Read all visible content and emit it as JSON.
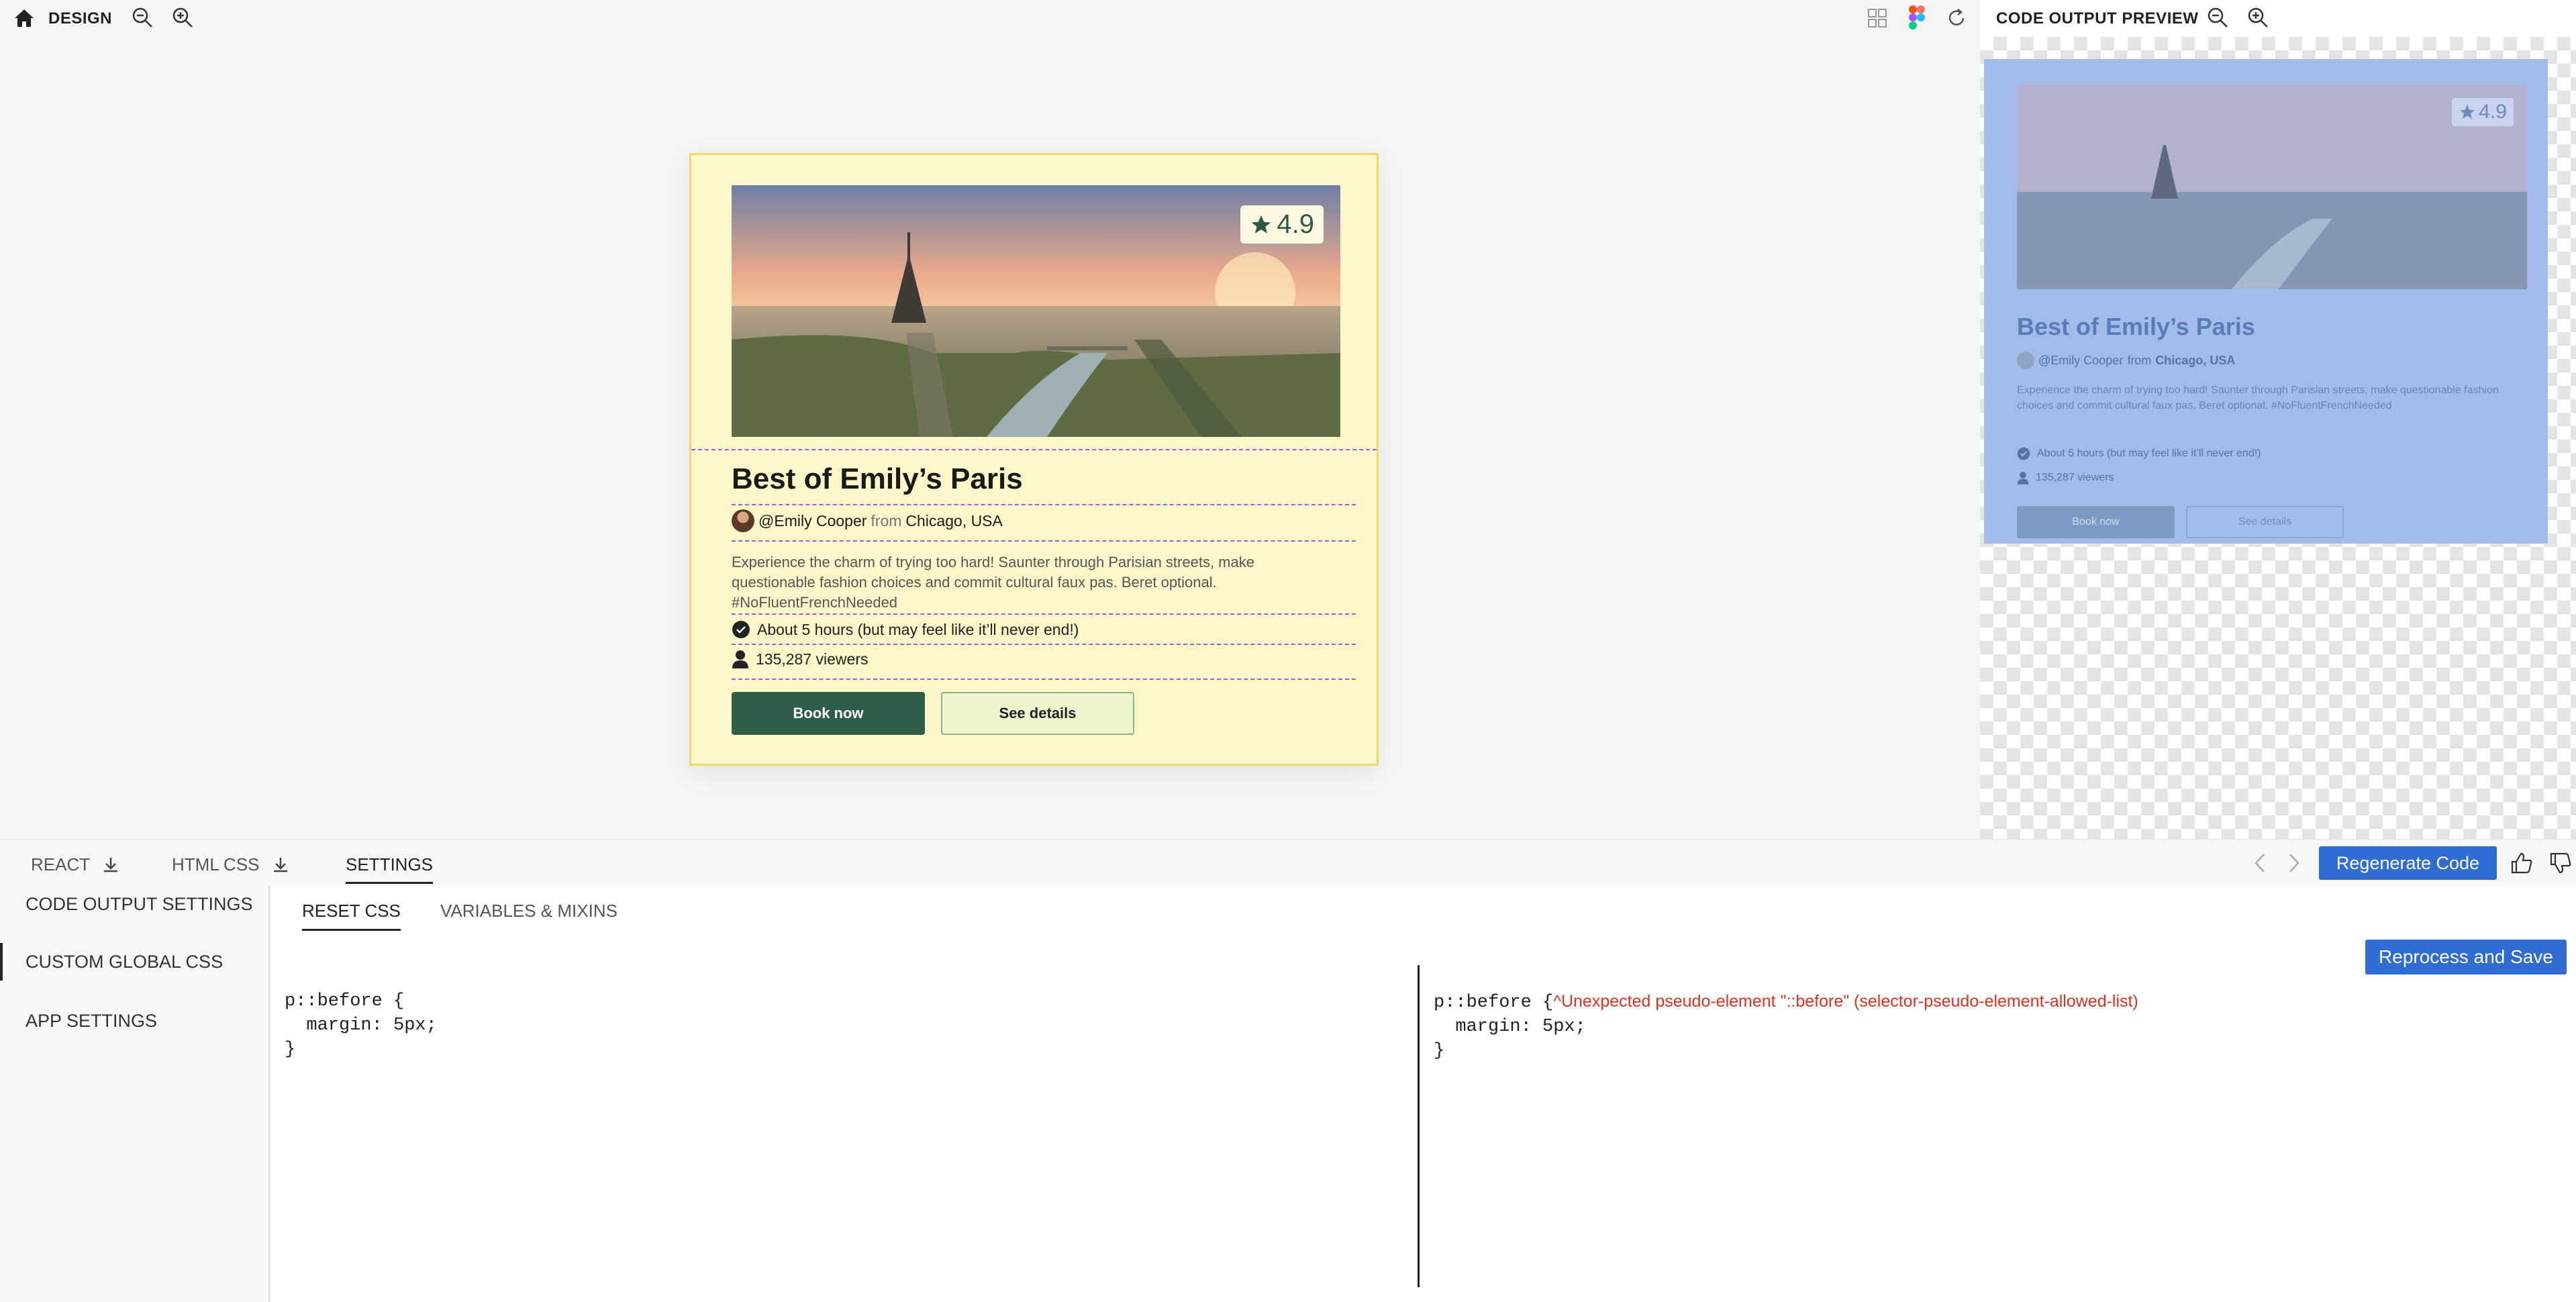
{
  "design_bar": {
    "title": "DESIGN"
  },
  "preview_bar": {
    "title": "CODE OUTPUT PREVIEW"
  },
  "card": {
    "rating": "4.9",
    "title": "Best of Emily’s Paris",
    "author": "@Emily Cooper",
    "from_word": "from",
    "location": "Chicago, USA",
    "description": "Experience the charm of trying too hard! Saunter through Parisian streets, make questionable fashion choices and commit cultural faux pas. Beret optional. #NoFluentFrenchNeeded",
    "duration": "About 5 hours (but may feel like it’ll never end!)",
    "viewers": "135,287 viewers",
    "book_label": "Book now",
    "details_label": "See details"
  },
  "bottom_tabs": {
    "react": "REACT",
    "html_css": "HTML CSS",
    "settings": "SETTINGS",
    "regenerate": "Regenerate Code"
  },
  "settings_sidebar": {
    "items": [
      "CODE OUTPUT SETTINGS",
      "CUSTOM GLOBAL CSS",
      "APP SETTINGS"
    ]
  },
  "editor": {
    "tabs": [
      "RESET CSS",
      "VARIABLES & MIXINS"
    ],
    "reprocess_label": "Reprocess and Save",
    "code_lines": [
      "p::before {",
      "  margin: 5px;",
      "}"
    ],
    "error_message": "^Unexpected pseudo-element \"::before\" (selector-pseudo-element-allowed-list)"
  },
  "colors": {
    "accent": "#2f6cd3",
    "card_bg": "#fdf6c9",
    "primary_button": "#2f5e48",
    "error": "#e0301e"
  }
}
